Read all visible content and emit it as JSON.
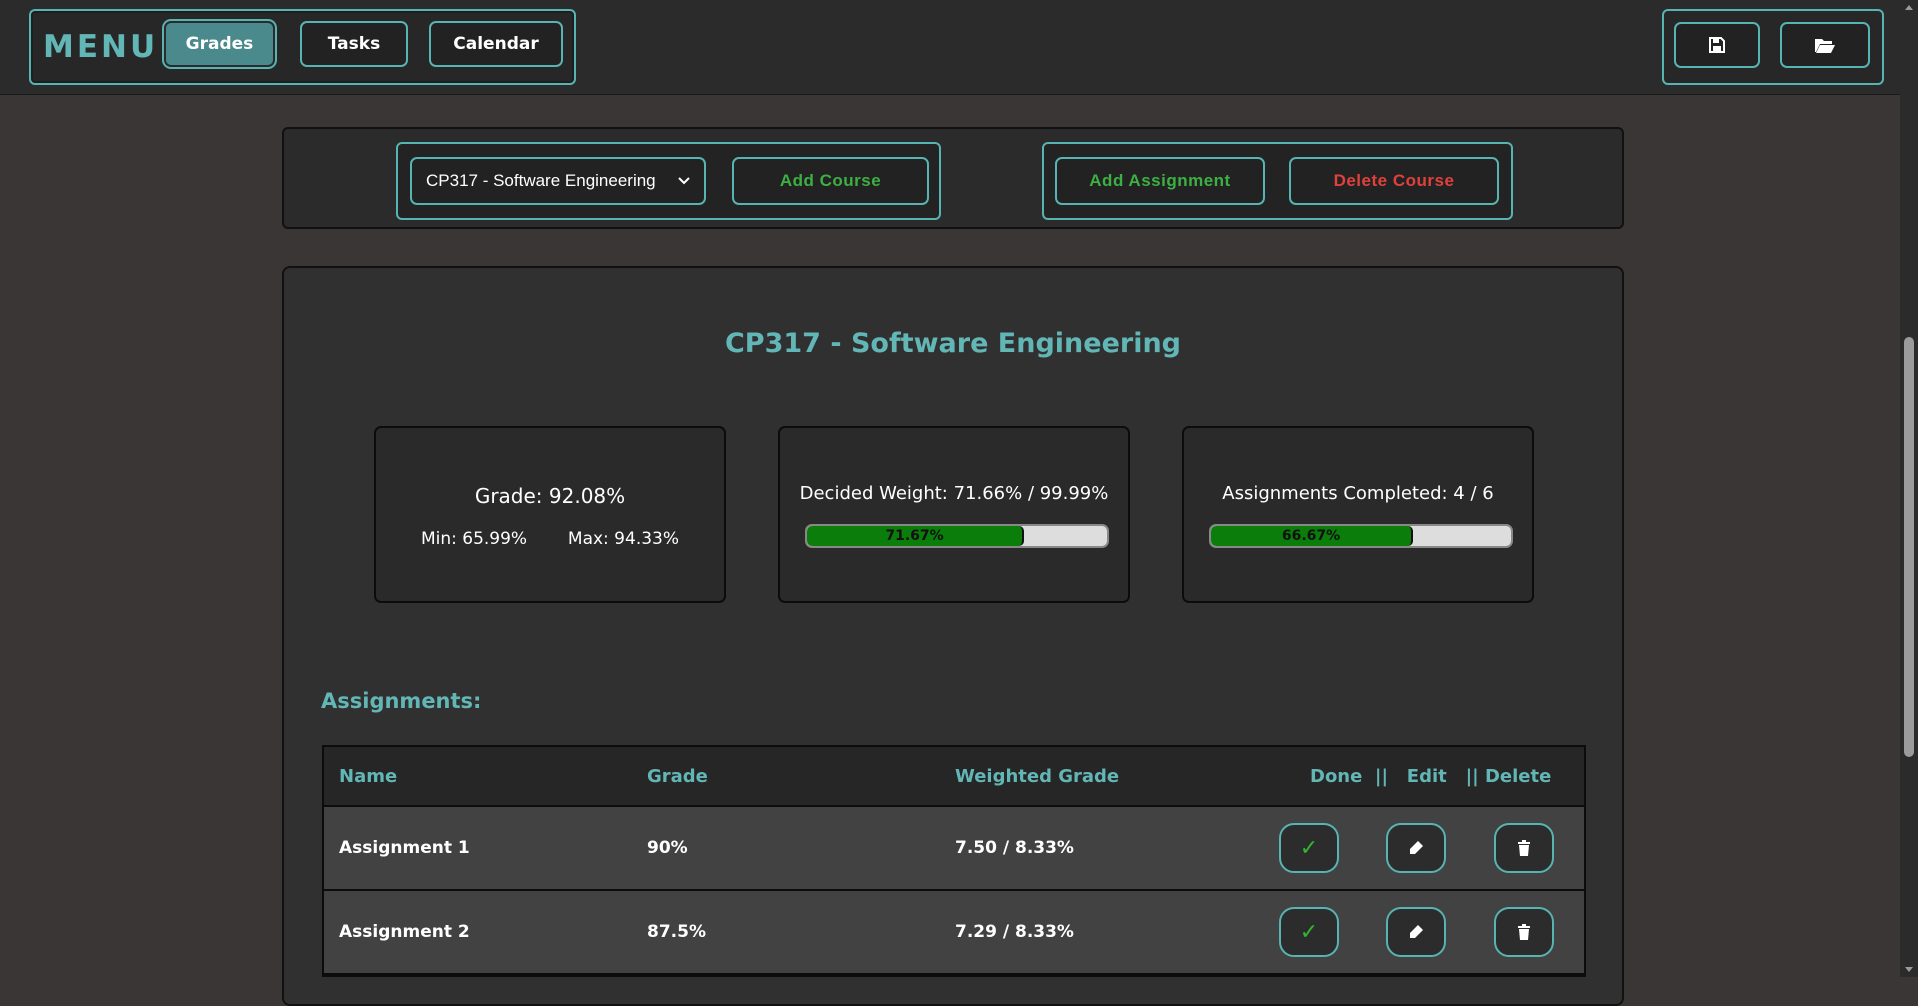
{
  "topbar": {
    "menu_title": "MENU",
    "nav": [
      {
        "label": "Grades",
        "active": true
      },
      {
        "label": "Tasks",
        "active": false
      },
      {
        "label": "Calendar",
        "active": false
      }
    ],
    "file_actions": [
      {
        "icon": "save-icon"
      },
      {
        "icon": "folder-open-icon"
      }
    ]
  },
  "controls": {
    "course_select_value": "CP317 - Software Engineering",
    "add_course_label": "Add Course",
    "add_assignment_label": "Add Assignment",
    "delete_course_label": "Delete Course"
  },
  "course": {
    "title": "CP317 - Software Engineering",
    "grade_text": "Grade: 92.08%",
    "min_text": "Min: 65.99%",
    "max_text": "Max: 94.33%",
    "weight_text": "Decided Weight: 71.66% / 99.99%",
    "weight_progress": 71.67,
    "weight_progress_label": "71.67%",
    "completed_text": "Assignments Completed: 4 / 6",
    "completed_progress": 66.67,
    "completed_progress_label": "66.67%"
  },
  "assignments": {
    "heading": "Assignments:",
    "headers": {
      "name": "Name",
      "grade": "Grade",
      "weighted": "Weighted Grade",
      "actions": "Done  ||   Edit   || Delete"
    },
    "rows": [
      {
        "name": "Assignment 1",
        "grade": "90%",
        "weighted": "7.50 / 8.33%"
      },
      {
        "name": "Assignment 2",
        "grade": "87.5%",
        "weighted": "7.29 / 8.33%"
      }
    ]
  },
  "colors": {
    "accent": "#62b6b6",
    "green_text": "#3cb043",
    "red_text": "#e0413c",
    "progress_fill": "#0a7d0a"
  }
}
